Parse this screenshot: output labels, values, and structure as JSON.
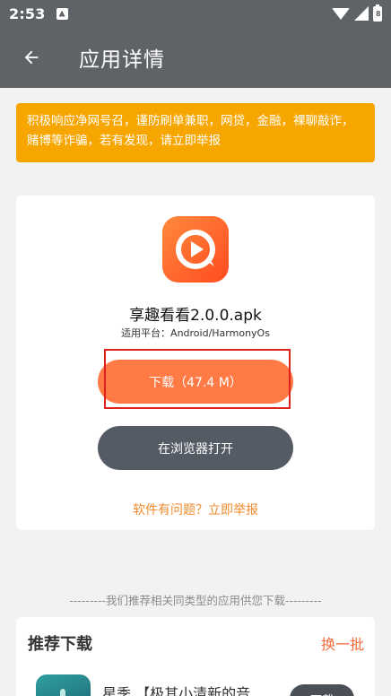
{
  "status_bar": {
    "time": "2:53",
    "sim_icon": "sim-alert-icon",
    "wifi_icon": "wifi-icon",
    "signal_icon": "signal-icon",
    "battery_icon": "battery-icon",
    "battery_glyph": "8"
  },
  "app_bar": {
    "back_icon": "arrow-back-icon",
    "title": "应用详情"
  },
  "notice": {
    "text": "积极响应净网号召，谨防刷单兼职，网贷，金融，裸聊敲诈，赌博等诈骗，若有发现，请立即举报",
    "background": "#f7a600"
  },
  "app": {
    "icon": "play-circle-app-icon",
    "name": "享趣看看2.0.0.apk",
    "platform": "适用平台：Android/HarmonyOs",
    "download_label": "下载（47.4 M）",
    "browser_label": "在浏览器打开",
    "report_label": "软件有问题？立即举报"
  },
  "recommend": {
    "note": "---------我们推荐相关同类型的应用供您下载---------",
    "title": "推荐下载",
    "refresh_label": "换一批",
    "items": [
      {
        "name": "星季 【极其小清新的音...",
        "download_label": "下载"
      }
    ]
  },
  "colors": {
    "appbar": "#5f6368",
    "accent": "#ff7a45",
    "dark_button": "#555b65",
    "report": "#f08a2b",
    "highlight_box": "#e0201b"
  }
}
